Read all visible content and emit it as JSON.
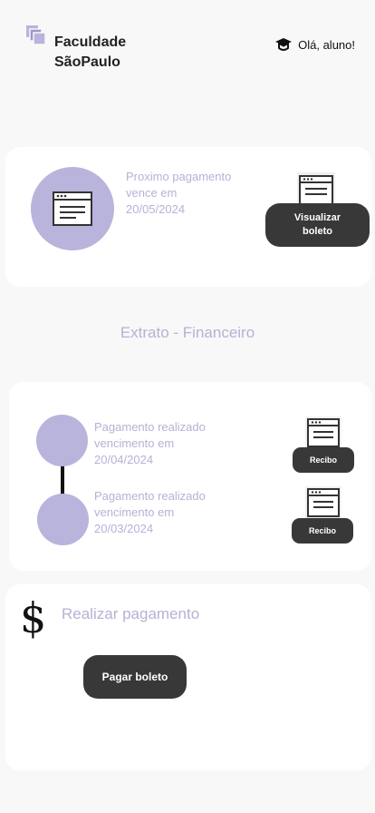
{
  "header": {
    "brand_line1": "Faculdade",
    "brand_line2": "SãoPaulo",
    "greeting": "Olá, aluno!"
  },
  "next_payment": {
    "line1": "Proximo pagamento",
    "line2": "vence em",
    "date": "20/05/2024",
    "button_line1": "Visualizar",
    "button_line2": "boleto"
  },
  "statement": {
    "title": "Extrato - Financeiro",
    "items": [
      {
        "status": "Pagamento realizado",
        "due_label": "vencimento em",
        "date": "20/04/2024",
        "button": "Recibo"
      },
      {
        "status": "Pagamento realizado",
        "due_label": "vencimento em",
        "date": "20/03/2024",
        "button": "Recibo"
      }
    ]
  },
  "payment": {
    "icon": "dollar-sign-icon",
    "symbol": "$",
    "title": "Realizar pagamento",
    "button": "Pagar boleto"
  },
  "colors": {
    "accent": "#b9b4dc",
    "accent_text": "#b6b1d6",
    "button_bg": "#383838",
    "background": "#f8f8f8"
  }
}
